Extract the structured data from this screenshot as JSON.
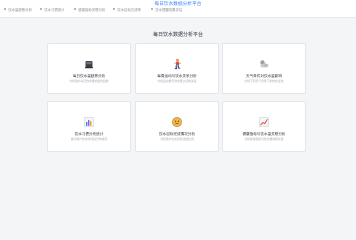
{
  "app": {
    "title": "每日饮水数据分析平台"
  },
  "tabs": [
    {
      "label": "饮水量趋势分析"
    },
    {
      "label": "饮水习惯统计"
    },
    {
      "label": "健康指标关联分析"
    },
    {
      "label": "饮水目标达成率"
    },
    {
      "label": "饮水提醒效果评估"
    }
  ],
  "main": {
    "heading": "每日饮水数据分析平台"
  },
  "cards": [
    {
      "title": "每日饮水量趋势分析",
      "desc": "分析用户每日饮水量的变化趋势",
      "icon": "cup-icon"
    },
    {
      "title": "每周运动与饮水关系分析",
      "desc": "分析运动量与饮水量之间的关系",
      "icon": "running-person-icon"
    },
    {
      "title": "天气条件对饮水量影响",
      "desc": "分析不同天气条件下的饮水变化",
      "icon": "weather-icon"
    },
    {
      "title": "饮水习惯分布统计",
      "desc": "统计用户饮水时间段分布情况",
      "icon": "bar-chart-icon"
    },
    {
      "title": "饮水目标完成情况分析",
      "desc": "分析用户饮水目标达成比例",
      "icon": "target-icon"
    },
    {
      "title": "健康指标与饮水量关联分析",
      "desc": "分析健康指标与饮水量的相关性",
      "icon": "trend-chart-icon"
    }
  ]
}
